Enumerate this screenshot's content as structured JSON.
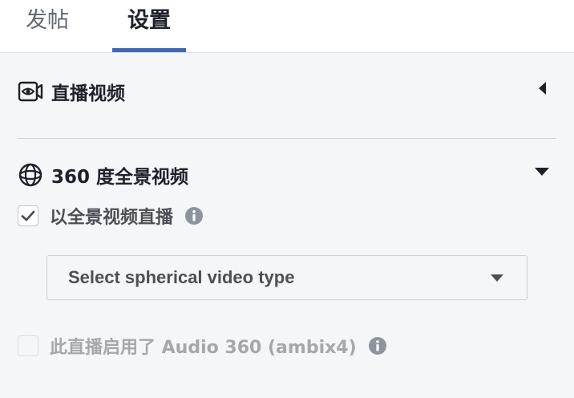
{
  "tabs": [
    {
      "label": "发帖",
      "active": false
    },
    {
      "label": "设置",
      "active": true
    }
  ],
  "colors": {
    "accent": "#4267b2",
    "background": "#f5f6f7",
    "text": "#1d2129"
  },
  "sections": {
    "live_video": {
      "title": "直播视频",
      "icon": "video-camera-eye-icon",
      "expanded": false
    },
    "video_360": {
      "title": "360 度全景视频",
      "icon": "globe-360-icon",
      "expanded": true,
      "live_360_option": {
        "label": "以全景视频直播",
        "checked": true
      },
      "spherical_select": {
        "value": "Select spherical video type"
      },
      "audio_360_option": {
        "label": "此直播启用了 Audio 360 (ambix4)",
        "checked": false,
        "disabled": true
      }
    }
  }
}
